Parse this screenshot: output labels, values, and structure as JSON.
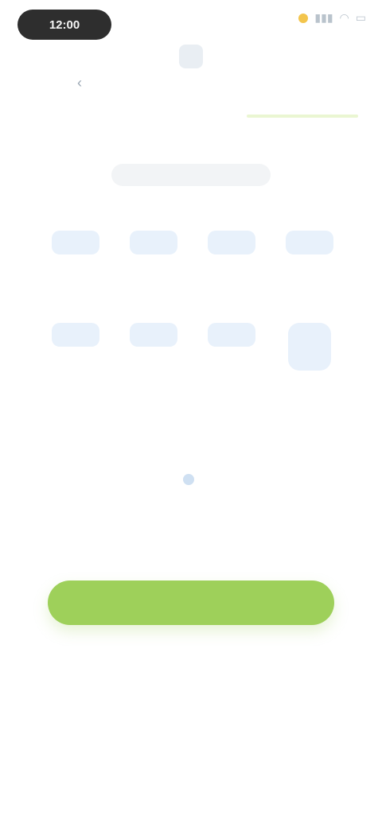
{
  "status_bar": {
    "time": "12:00",
    "icons": [
      "signal-icon",
      "wifi-icon",
      "battery-icon"
    ]
  },
  "header": {
    "back_label": "",
    "title": "",
    "right_label": ""
  },
  "page_title": "",
  "grid": {
    "items": [
      {
        "value": "",
        "label": ""
      },
      {
        "value": "",
        "label": ""
      },
      {
        "value": "",
        "label": ""
      },
      {
        "value": "",
        "label": ""
      },
      {
        "value": "",
        "label": ""
      },
      {
        "value": "",
        "label": ""
      },
      {
        "value": "",
        "label": ""
      },
      {
        "value": "",
        "label": ""
      }
    ]
  },
  "hint_text": "",
  "link_text": "",
  "terms_text": "",
  "primary_button": {
    "label": ""
  },
  "colors": {
    "accent": "#9ed05a",
    "card_bg": "#e8f1fb",
    "card_text": "#6ea0d4"
  }
}
